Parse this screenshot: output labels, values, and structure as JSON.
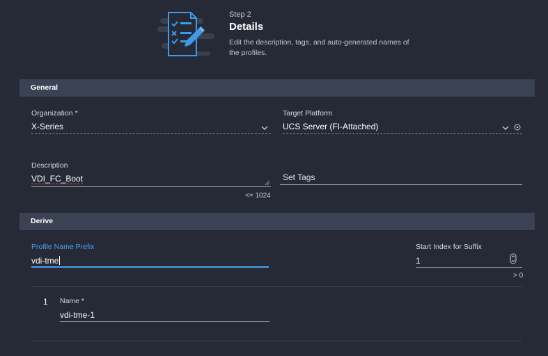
{
  "header": {
    "step_label": "Step 2",
    "title": "Details",
    "description": "Edit the description, tags, and auto-generated names of the profiles."
  },
  "general": {
    "section_title": "General",
    "organization": {
      "label": "Organization *",
      "value": "X-Series"
    },
    "target_platform": {
      "label": "Target Platform",
      "value": "UCS Server (FI-Attached)"
    },
    "description": {
      "label": "Description",
      "value": "VDI_FC_Boot",
      "hint": "<= 1024"
    },
    "tags": {
      "placeholder": "Set Tags"
    }
  },
  "derive": {
    "section_title": "Derive",
    "prefix": {
      "label": "Profile Name Prefix",
      "value": "vdi-tme"
    },
    "start_index": {
      "label": "Start Index for Suffix",
      "value": "1",
      "hint": "> 0"
    },
    "profiles": [
      {
        "index": "1",
        "name_label": "Name *",
        "name_value": "vdi-tme-1"
      }
    ]
  },
  "colors": {
    "background": "#262a37",
    "section_bar": "#3a4253",
    "accent": "#4aa3f0",
    "illustration_blue": "#3d9be9"
  },
  "icons": [
    "document-checklist-icon",
    "pencil-icon",
    "chevron-down-icon",
    "info-icon",
    "stepper-icon",
    "resize-handle-icon"
  ]
}
